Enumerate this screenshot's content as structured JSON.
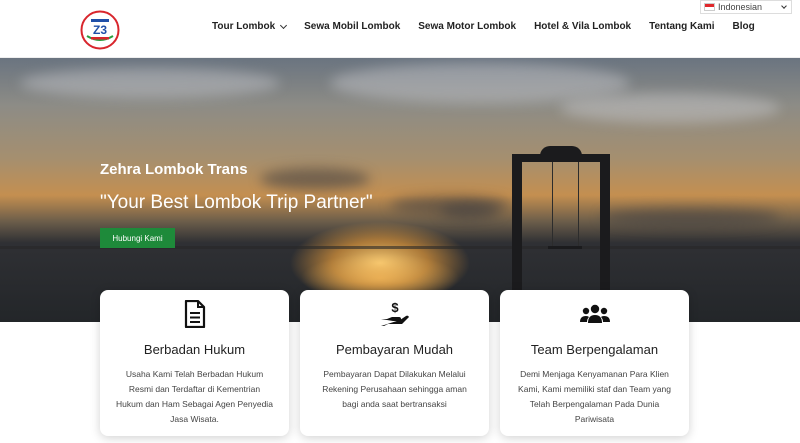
{
  "header": {
    "logo_icon": "zehra-lombok-trans-logo",
    "nav": [
      {
        "label": "Tour Lombok",
        "has_dropdown": true
      },
      {
        "label": "Sewa Mobil Lombok"
      },
      {
        "label": "Sewa Motor Lombok"
      },
      {
        "label": "Hotel & Vila Lombok"
      },
      {
        "label": "Tentang Kami"
      },
      {
        "label": "Blog"
      }
    ],
    "language": {
      "selected": "Indonesian",
      "flag_icon": "indonesia-flag-icon"
    }
  },
  "hero": {
    "subtitle": "Zehra Lombok Trans",
    "title": "\"Your Best Lombok Trip Partner\"",
    "cta_label": "Hubungi Kami",
    "cta_color": "#1e8a3a"
  },
  "features": [
    {
      "icon": "document-icon",
      "title": "Berbadan Hukum",
      "description": "Usaha Kami Telah Berbadan Hukum Resmi dan Terdaftar di Kementrian Hukum dan Ham Sebagai Agen Penyedia Jasa Wisata."
    },
    {
      "icon": "hand-dollar-icon",
      "title": "Pembayaran Mudah",
      "description": "Pembayaran Dapat Dilakukan Melalui Rekening Perusahaan sehingga aman bagi anda saat bertransaksi"
    },
    {
      "icon": "users-icon",
      "title": "Team Berpengalaman",
      "description": "Demi Menjaga Kenyamanan Para Klien Kami, Kami memiliki staf dan Team yang Telah Berpengalaman Pada Dunia Pariwisata"
    }
  ]
}
